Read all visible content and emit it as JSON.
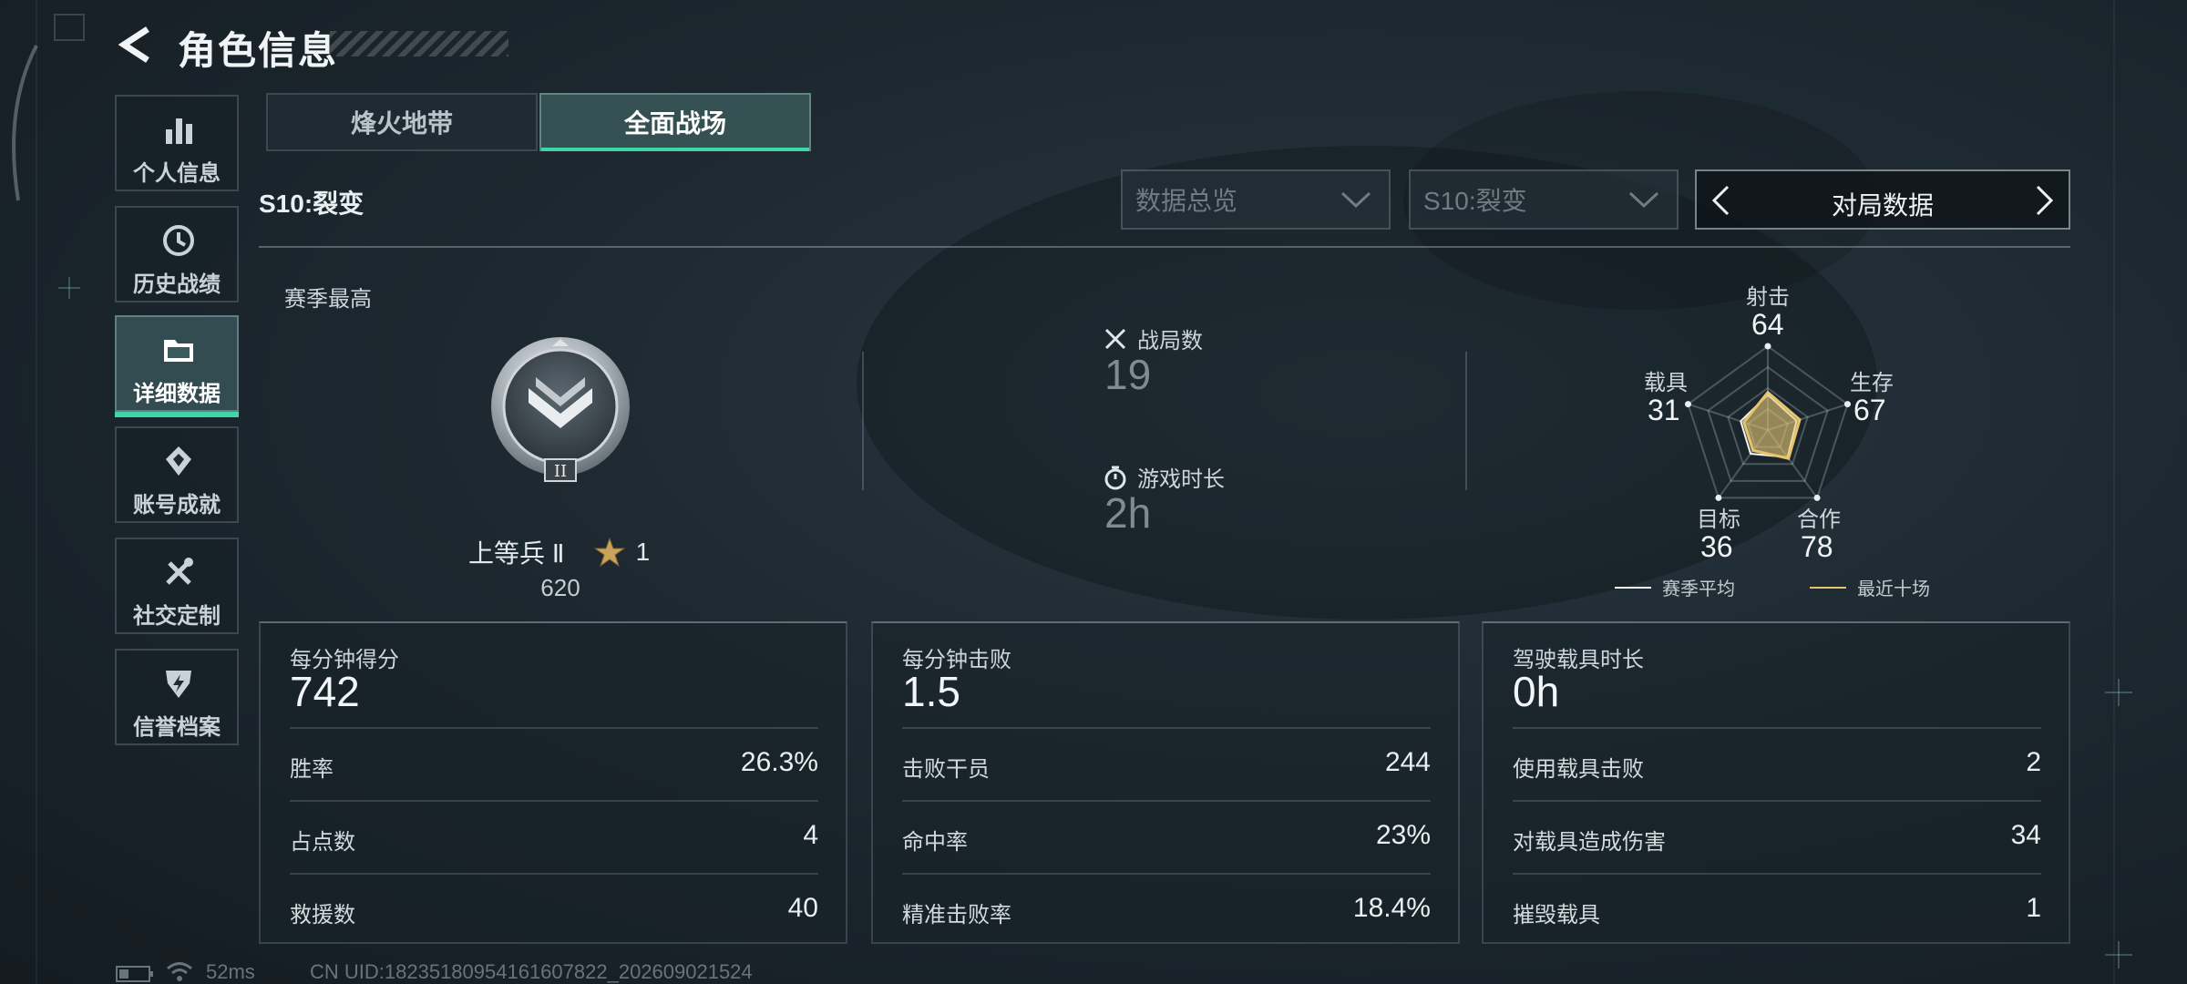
{
  "header": {
    "title": "角色信息"
  },
  "sidebar": {
    "items": [
      {
        "label": "个人信息",
        "icon": "bar-chart-icon",
        "active": false
      },
      {
        "label": "历史战绩",
        "icon": "history-clock-icon",
        "active": false
      },
      {
        "label": "详细数据",
        "icon": "folder-icon",
        "active": true
      },
      {
        "label": "账号成就",
        "icon": "achievement-badge-icon",
        "active": false
      },
      {
        "label": "社交定制",
        "icon": "tools-icon",
        "active": false
      },
      {
        "label": "信誉档案",
        "icon": "credit-shield-icon",
        "active": false
      }
    ]
  },
  "mode_tabs": [
    {
      "label": "烽火地带",
      "selected": false
    },
    {
      "label": "全面战场",
      "selected": true
    }
  ],
  "season": {
    "name": "S10:裂变"
  },
  "filters": {
    "data_type": "数据总览",
    "season": "S10:裂变",
    "page_label": "对局数据"
  },
  "rank": {
    "section_label": "赛季最高",
    "name": "上等兵 Ⅱ",
    "stars": "1",
    "score": "620"
  },
  "match_stats": {
    "matches_label": "战局数",
    "matches_value": "19",
    "playtime_label": "游戏时长",
    "playtime_value": "2h"
  },
  "radar": {
    "axes": [
      {
        "label": "射击",
        "value": "64"
      },
      {
        "label": "生存",
        "value": "67"
      },
      {
        "label": "合作",
        "value": "78"
      },
      {
        "label": "目标",
        "value": "36"
      },
      {
        "label": "载具",
        "value": "31"
      }
    ],
    "recent_fraction": [
      0.45,
      0.4,
      0.42,
      0.3,
      0.3
    ],
    "season_avg_fraction": [
      0.42,
      0.36,
      0.4,
      0.35,
      0.34
    ],
    "legend": {
      "season_avg": "赛季平均",
      "recent": "最近十场"
    },
    "colors": {
      "recent": "#e6c56a",
      "season_avg": "#f2f2f2"
    }
  },
  "panels": [
    {
      "title": "每分钟得分",
      "value": "742",
      "rows": [
        {
          "label": "胜率",
          "value": "26.3%"
        },
        {
          "label": "占点数",
          "value": "4"
        },
        {
          "label": "救援数",
          "value": "40"
        }
      ]
    },
    {
      "title": "每分钟击败",
      "value": "1.5",
      "rows": [
        {
          "label": "击败干员",
          "value": "244"
        },
        {
          "label": "命中率",
          "value": "23%"
        },
        {
          "label": "精准击败率",
          "value": "18.4%"
        }
      ]
    },
    {
      "title": "驾驶载具时长",
      "value": "0h",
      "rows": [
        {
          "label": "使用载具击败",
          "value": "2"
        },
        {
          "label": "对载具造成伤害",
          "value": "34"
        },
        {
          "label": "摧毁载具",
          "value": "1"
        }
      ]
    }
  ],
  "footer": {
    "ping": "52ms",
    "uid": "CN UID:18235180954161607822_202609021524"
  },
  "colors": {
    "accent": "#3fd6a7"
  }
}
